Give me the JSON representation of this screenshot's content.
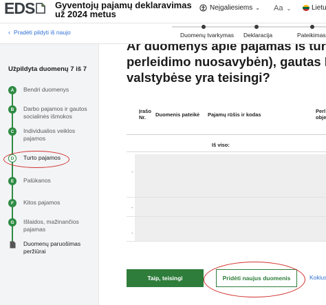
{
  "header": {
    "logo_text": "EDS",
    "title": "Gyventojų pajamų deklaravimas už 2024 metus",
    "accessibility_label": "Neįgaliesiems",
    "font_size_label": "Aa",
    "language_label": "Lietu"
  },
  "subnav": {
    "back_label": "Pradėti pildyti iš naujo",
    "steps": [
      "Duomenų tvarkymas",
      "Deklaracija",
      "Pateikimas"
    ]
  },
  "sidebar": {
    "progress_prefix": "Užpildyta duomenų",
    "progress_value": "7 iš 7",
    "items": [
      {
        "badge": "A",
        "label": "Bendri duomenys",
        "state": "done"
      },
      {
        "badge": "B",
        "label": "Darbo pajamos ir gautos socialinės išmokos",
        "state": "done"
      },
      {
        "badge": "C",
        "label": "Individualios veiklos pajamos",
        "state": "done"
      },
      {
        "badge": "D",
        "label": "Turto pajamos",
        "state": "current"
      },
      {
        "badge": "E",
        "label": "Palūkanos",
        "state": "done"
      },
      {
        "badge": "F",
        "label": "Kitos pajamos",
        "state": "done"
      },
      {
        "badge": "G",
        "label": "Išlaidos, mažinančios pajamas",
        "state": "done"
      },
      {
        "badge": "",
        "label": "Duomenų paruošimas peržiūrai",
        "state": "doc"
      }
    ]
  },
  "main": {
    "question": "Ar duomenys apie pajamas iš turto (išskyrus perleidimo nuosavybėn), gautas Lietuvos valstybėse yra teisingi?",
    "question_lines": [
      "Ar duomenys apie pajamas iš turto",
      "perleidimo nuosavybėn), gautas Lie",
      "valstybėse yra teisingi?"
    ],
    "table": {
      "columns": [
        "Įrašo Nr.",
        "Duomenis pateikė",
        "Pajamų rūšis ir kodas",
        "Perl obje"
      ],
      "total_label": "Iš viso:",
      "row_dash": "-"
    },
    "buttons": {
      "confirm": "Taip, teisingi",
      "add": "Pridėti naujus duomenis",
      "other": "Kokius"
    }
  },
  "colors": {
    "accent_green": "#2e7d3b",
    "link_blue": "#2f6fd6",
    "annotation_red": "#d0312d"
  }
}
